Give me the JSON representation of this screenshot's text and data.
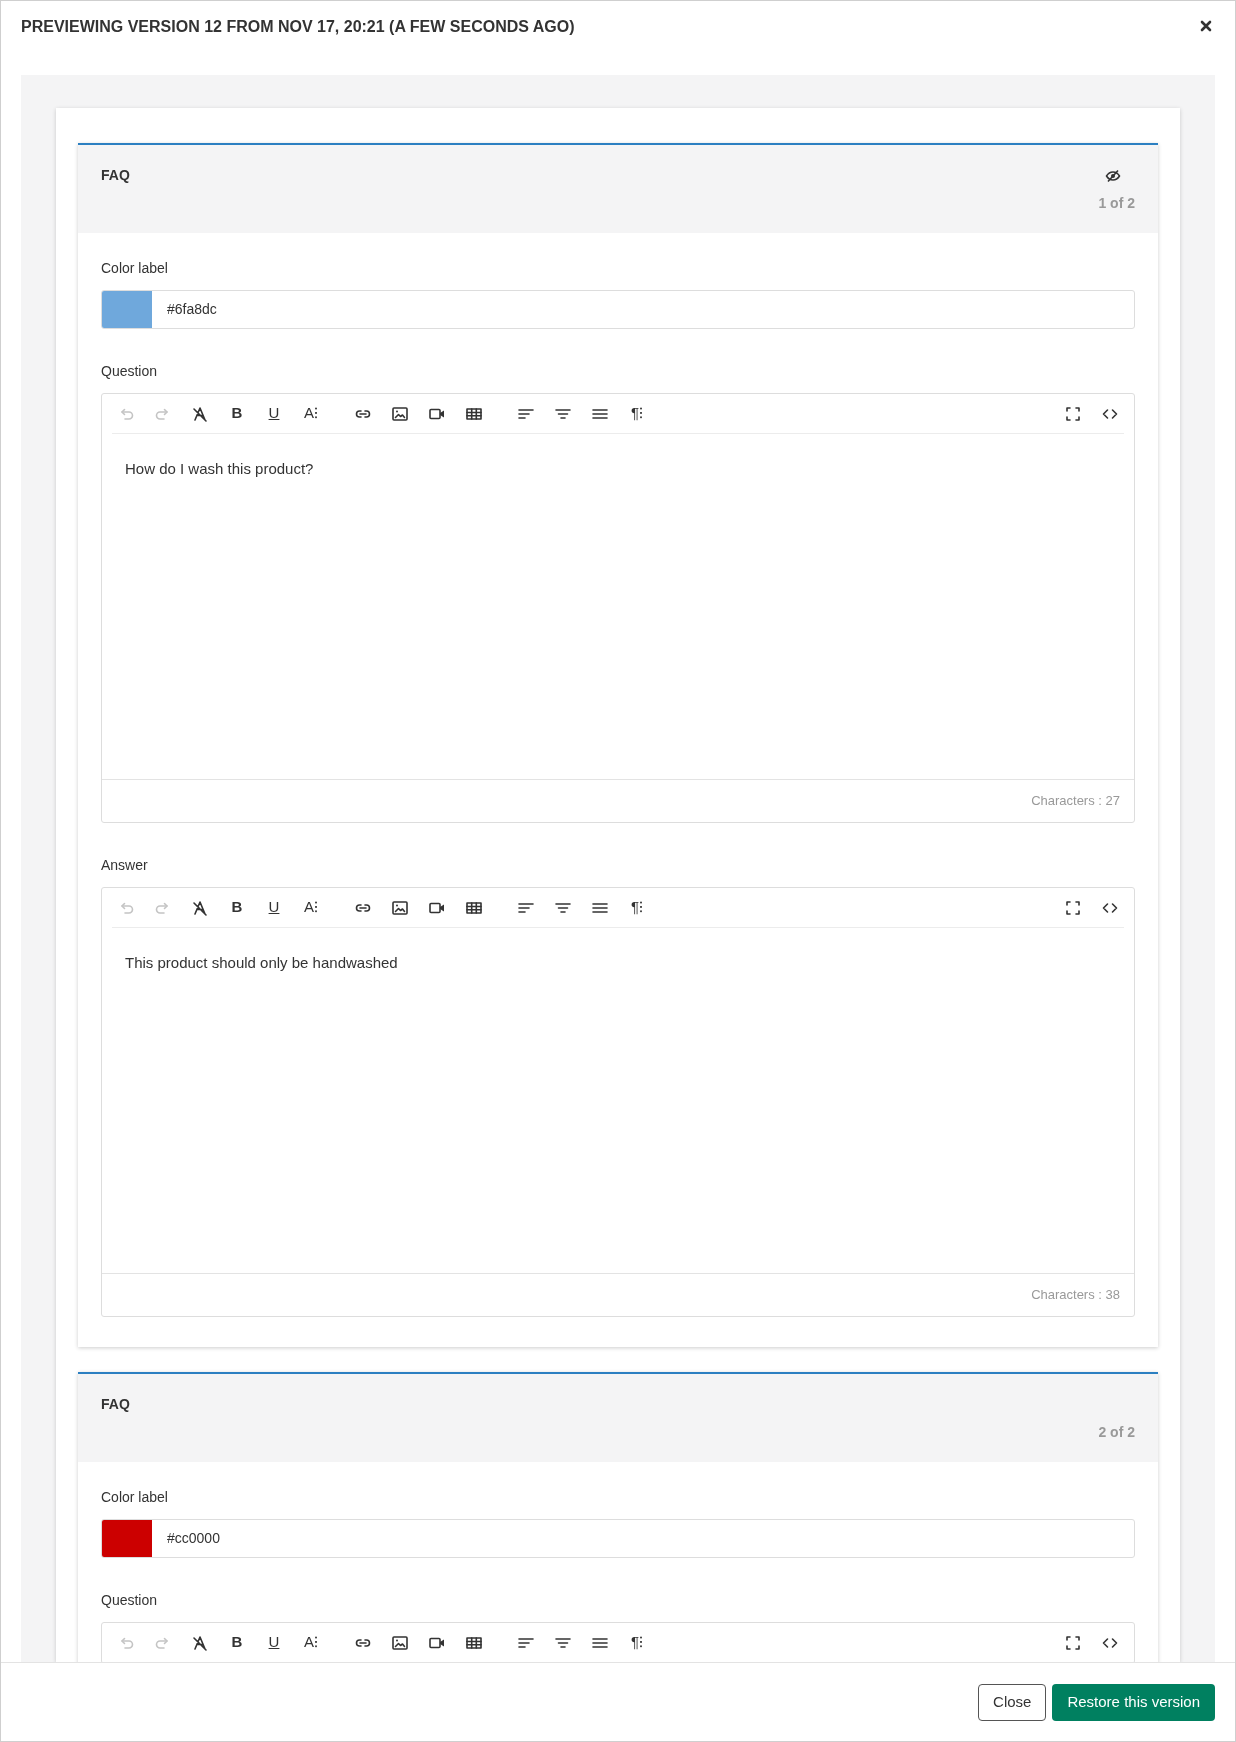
{
  "dialog": {
    "title": "PREVIEWING VERSION 12 FROM NOV 17, 20:21 (A FEW SECONDS AGO)"
  },
  "blocks": [
    {
      "heading": "FAQ",
      "hidden": true,
      "counter": "1 of 2",
      "fields": [
        {
          "kind": "color",
          "label": "Color label",
          "color": "#6fa8dc",
          "value": "#6fa8dc"
        },
        {
          "kind": "richtext",
          "label": "Question",
          "toolbar": [
            [
              {
                "kind": "undo",
                "disabled": true
              },
              {
                "kind": "redo",
                "disabled": true
              },
              {
                "kind": "clear-format",
                "disabled": false
              },
              {
                "kind": "bold",
                "glyph": "B",
                "disabled": false
              },
              {
                "kind": "underline",
                "glyph": "U",
                "disabled": false
              },
              {
                "kind": "font-size",
                "glyph": "A⁝",
                "disabled": false
              }
            ],
            [
              {
                "kind": "link",
                "disabled": false
              },
              {
                "kind": "image",
                "disabled": false
              },
              {
                "kind": "video",
                "disabled": false
              },
              {
                "kind": "table",
                "disabled": false
              }
            ],
            [
              {
                "kind": "align-left",
                "disabled": false
              },
              {
                "kind": "align-center",
                "disabled": false
              },
              {
                "kind": "justify",
                "disabled": false
              },
              {
                "kind": "paragraph",
                "glyph": "¶⁝",
                "disabled": false
              }
            ],
            [
              {
                "kind": "fullscreen",
                "disabled": false
              },
              {
                "kind": "code",
                "disabled": false
              }
            ]
          ],
          "text": "How do I wash this product?",
          "count": "Characters : 27"
        },
        {
          "kind": "richtext",
          "label": "Answer",
          "toolbar": [
            [
              {
                "kind": "undo",
                "disabled": true
              },
              {
                "kind": "redo",
                "disabled": true
              },
              {
                "kind": "clear-format",
                "disabled": false
              },
              {
                "kind": "bold",
                "glyph": "B",
                "disabled": false
              },
              {
                "kind": "underline",
                "glyph": "U",
                "disabled": false
              },
              {
                "kind": "font-size",
                "glyph": "A⁝",
                "disabled": false
              }
            ],
            [
              {
                "kind": "link",
                "disabled": false
              },
              {
                "kind": "image",
                "disabled": false
              },
              {
                "kind": "video",
                "disabled": false
              },
              {
                "kind": "table",
                "disabled": false
              }
            ],
            [
              {
                "kind": "align-left",
                "disabled": false
              },
              {
                "kind": "align-center",
                "disabled": false
              },
              {
                "kind": "justify",
                "disabled": false
              },
              {
                "kind": "paragraph",
                "glyph": "¶⁝",
                "disabled": false
              }
            ],
            [
              {
                "kind": "fullscreen",
                "disabled": false
              },
              {
                "kind": "code",
                "disabled": false
              }
            ]
          ],
          "text": "This product should only be handwashed",
          "count": "Characters : 38"
        }
      ]
    },
    {
      "heading": "FAQ",
      "hidden": false,
      "counter": "2 of 2",
      "fields": [
        {
          "kind": "color",
          "label": "Color label",
          "color": "#cc0000",
          "value": "#cc0000"
        },
        {
          "kind": "richtext",
          "label": "Question",
          "toolbar": [
            [
              {
                "kind": "undo",
                "disabled": true
              },
              {
                "kind": "redo",
                "disabled": true
              },
              {
                "kind": "clear-format",
                "disabled": false
              },
              {
                "kind": "bold",
                "glyph": "B",
                "disabled": false
              },
              {
                "kind": "underline",
                "glyph": "U",
                "disabled": false
              },
              {
                "kind": "font-size",
                "glyph": "A⁝",
                "disabled": false
              }
            ],
            [
              {
                "kind": "link",
                "disabled": false
              },
              {
                "kind": "image",
                "disabled": false
              },
              {
                "kind": "video",
                "disabled": false
              },
              {
                "kind": "table",
                "disabled": false
              }
            ],
            [
              {
                "kind": "align-left",
                "disabled": false
              },
              {
                "kind": "align-center",
                "disabled": false
              },
              {
                "kind": "justify",
                "disabled": false
              },
              {
                "kind": "paragraph",
                "glyph": "¶⁝",
                "disabled": false
              }
            ],
            [
              {
                "kind": "fullscreen",
                "disabled": false
              },
              {
                "kind": "code",
                "disabled": false
              }
            ]
          ]
        }
      ]
    }
  ],
  "footer": {
    "buttons": [
      {
        "label": "Close",
        "kind": "secondary"
      },
      {
        "label": "Restore this version",
        "kind": "primary"
      }
    ]
  }
}
